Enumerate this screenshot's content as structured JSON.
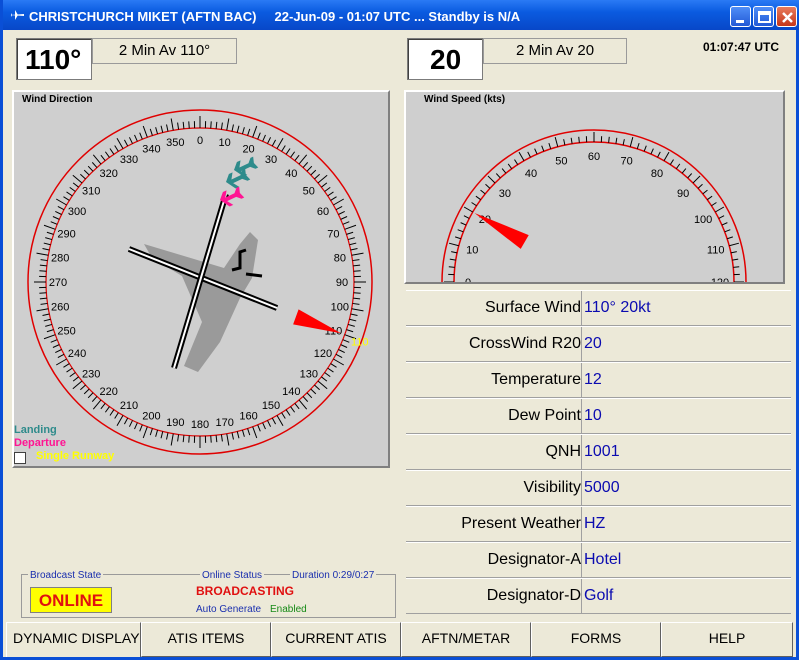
{
  "window": {
    "title": "CHRISTCHURCH MIKET (AFTN BAC)     22-Jun-09 - 01:07 UTC ... Standby is N/A"
  },
  "direction": {
    "value": "110°",
    "avg": "2 Min Av 110°"
  },
  "speed": {
    "value": "20",
    "avg": "2 Min Av 20"
  },
  "clock": "01:07:47 UTC",
  "wind_direction_panel": {
    "title": "Wind Direction",
    "heading_deg": 110,
    "heading_label": "110",
    "dial_labels": [
      "0",
      "10",
      "20",
      "30",
      "40",
      "50",
      "60",
      "70",
      "80",
      "90",
      "100",
      "110",
      "120",
      "130",
      "140",
      "150",
      "160",
      "170",
      "180",
      "190",
      "200",
      "210",
      "220",
      "230",
      "240",
      "250",
      "260",
      "270",
      "280",
      "290",
      "300",
      "310",
      "320",
      "330",
      "340",
      "350"
    ],
    "legend": {
      "landing": "Landing",
      "departure": "Departure",
      "single_runway": "Single Runway"
    }
  },
  "wind_speed_panel": {
    "title": "Wind Speed (kts)",
    "value_kts": 20,
    "range": [
      0,
      120
    ],
    "dial_labels": [
      "0",
      "10",
      "20",
      "30",
      "40",
      "50",
      "60",
      "70",
      "80",
      "90",
      "100",
      "110",
      "120"
    ]
  },
  "info": [
    {
      "label": "Surface Wind",
      "value": "110° 20kt"
    },
    {
      "label": "CrossWind R20",
      "value": "20"
    },
    {
      "label": "Temperature",
      "value": "12"
    },
    {
      "label": "Dew Point",
      "value": "10"
    },
    {
      "label": "QNH",
      "value": "1001"
    },
    {
      "label": "Visibility",
      "value": "5000"
    },
    {
      "label": "Present Weather",
      "value": "HZ"
    },
    {
      "label": "Designator-A",
      "value": "Hotel"
    },
    {
      "label": "Designator-D",
      "value": "Golf"
    }
  ],
  "broadcast": {
    "state_label": "Broadcast State",
    "state": "ONLINE",
    "online_status_label": "Online Status",
    "duration": "Duration 0:29/0:27",
    "status": "BROADCASTING",
    "auto_generate_label": "Auto Generate",
    "auto_generate_value": "Enabled"
  },
  "tabs": [
    "DYNAMIC DISPLAY",
    "ATIS ITEMS",
    "CURRENT ATIS",
    "AFTN/METAR",
    "FORMS",
    "HELP"
  ],
  "colors": {
    "titlebar": "#0a5be0",
    "dial_red": "#e00000",
    "landing": "#2e8b8b",
    "departure": "#ff1493",
    "single_runway": "#ffff00",
    "value_blue": "#0b0bb0"
  }
}
